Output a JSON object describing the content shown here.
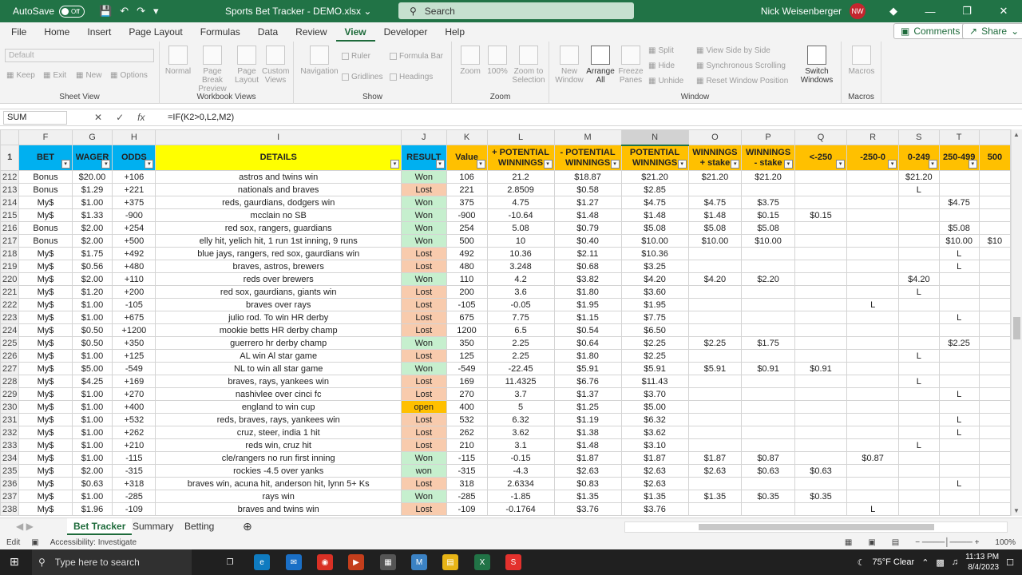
{
  "titlebar": {
    "autosave_label": "AutoSave",
    "autosave_state": "Off",
    "doc_title": "Sports Bet Tracker - DEMO.xlsx",
    "search_placeholder": "Search",
    "user_name": "Nick Weisenberger",
    "user_initials": "NW"
  },
  "menu": [
    "File",
    "Home",
    "Insert",
    "Page Layout",
    "Formulas",
    "Data",
    "Review",
    "View",
    "Developer",
    "Help"
  ],
  "menu_active": "View",
  "comments_label": "Comments",
  "share_label": "Share",
  "ribbon": {
    "sheet_view": {
      "dropdown": "Default",
      "keep": "Keep",
      "exit": "Exit",
      "new": "New",
      "options": "Options",
      "label": "Sheet View"
    },
    "workbook_views": {
      "normal": "Normal",
      "page_break": "Page Break Preview",
      "page_layout": "Page Layout",
      "custom": "Custom Views",
      "label": "Workbook Views"
    },
    "show": {
      "navigation": "Navigation",
      "ruler": "Ruler",
      "formula_bar": "Formula Bar",
      "gridlines": "Gridlines",
      "headings": "Headings",
      "label": "Show"
    },
    "zoom": {
      "zoom": "Zoom",
      "hundred": "100%",
      "to_selection": "Zoom to Selection",
      "label": "Zoom"
    },
    "window": {
      "new_window": "New Window",
      "arrange_all": "Arrange All",
      "freeze": "Freeze Panes",
      "split": "Split",
      "hide": "Hide",
      "unhide": "Unhide",
      "side_by_side": "View Side by Side",
      "sync_scroll": "Synchronous Scrolling",
      "reset_pos": "Reset Window Position",
      "switch": "Switch Windows",
      "label": "Window"
    },
    "macros": {
      "macros": "Macros",
      "label": "Macros"
    }
  },
  "formula_bar": {
    "name_box": "SUM",
    "formula": "=IF(K2>0,L2,M2)"
  },
  "columns": [
    "F",
    "G",
    "H",
    "I",
    "J",
    "K",
    "L",
    "M",
    "N",
    "O",
    "P",
    "Q",
    "R",
    "S",
    "T",
    ""
  ],
  "header_row_number": "1",
  "headers": [
    "BET",
    "WAGER",
    "ODDS",
    "DETAILS",
    "RESULT",
    "Value",
    "+ POTENTIAL WINNINGS",
    "- POTENTIAL WINNINGS",
    "POTENTIAL WINNINGS",
    "WINNINGS + stake",
    "WINNINGS - stake",
    "<-250",
    "-250-0",
    "0-249",
    "250-499",
    "500"
  ],
  "rows": [
    [
      "212",
      "Bonus",
      "$20.00",
      "+106",
      "astros and twins win",
      "Won",
      "106",
      "21.2",
      "$18.87",
      "$21.20",
      "$21.20",
      "$21.20",
      "",
      "",
      "$21.20",
      "",
      ""
    ],
    [
      "213",
      "Bonus",
      "$1.29",
      "+221",
      "nationals and braves",
      "Lost",
      "221",
      "2.8509",
      "$0.58",
      "$2.85",
      "",
      "",
      "",
      "",
      "L",
      "",
      ""
    ],
    [
      "214",
      "My$",
      "$1.00",
      "+375",
      "reds, gaurdians, dodgers win",
      "Won",
      "375",
      "4.75",
      "$1.27",
      "$4.75",
      "$4.75",
      "$3.75",
      "",
      "",
      "",
      "$4.75",
      ""
    ],
    [
      "215",
      "My$",
      "$1.33",
      "-900",
      "mcclain no SB",
      "Won",
      "-900",
      "-10.64",
      "$1.48",
      "$1.48",
      "$1.48",
      "$0.15",
      "$0.15",
      "",
      "",
      "",
      ""
    ],
    [
      "216",
      "Bonus",
      "$2.00",
      "+254",
      "red sox, rangers, guardians",
      "Won",
      "254",
      "5.08",
      "$0.79",
      "$5.08",
      "$5.08",
      "$5.08",
      "",
      "",
      "",
      "$5.08",
      ""
    ],
    [
      "217",
      "Bonus",
      "$2.00",
      "+500",
      "elly hit, yelich hit, 1 run 1st inning, 9 runs",
      "Won",
      "500",
      "10",
      "$0.40",
      "$10.00",
      "$10.00",
      "$10.00",
      "",
      "",
      "",
      "$10.00",
      "$10"
    ],
    [
      "218",
      "My$",
      "$1.75",
      "+492",
      "blue jays, rangers, red sox, gaurdians win",
      "Lost",
      "492",
      "10.36",
      "$2.11",
      "$10.36",
      "",
      "",
      "",
      "",
      "",
      "L",
      ""
    ],
    [
      "219",
      "My$",
      "$0.56",
      "+480",
      "braves, astros, brewers",
      "Lost",
      "480",
      "3.248",
      "$0.68",
      "$3.25",
      "",
      "",
      "",
      "",
      "",
      "L",
      ""
    ],
    [
      "220",
      "My$",
      "$2.00",
      "+110",
      "reds over brewers",
      "Won",
      "110",
      "4.2",
      "$3.82",
      "$4.20",
      "$4.20",
      "$2.20",
      "",
      "",
      "$4.20",
      "",
      ""
    ],
    [
      "221",
      "My$",
      "$1.20",
      "+200",
      "red sox, gaurdians, giants win",
      "Lost",
      "200",
      "3.6",
      "$1.80",
      "$3.60",
      "",
      "",
      "",
      "",
      "L",
      "",
      ""
    ],
    [
      "222",
      "My$",
      "$1.00",
      "-105",
      "braves over rays",
      "Lost",
      "-105",
      "-0.05",
      "$1.95",
      "$1.95",
      "",
      "",
      "",
      "L",
      "",
      "",
      ""
    ],
    [
      "223",
      "My$",
      "$1.00",
      "+675",
      "julio rod. To win HR derby",
      "Lost",
      "675",
      "7.75",
      "$1.15",
      "$7.75",
      "",
      "",
      "",
      "",
      "",
      "L",
      ""
    ],
    [
      "224",
      "My$",
      "$0.50",
      "+1200",
      "mookie betts HR derby champ",
      "Lost",
      "1200",
      "6.5",
      "$0.54",
      "$6.50",
      "",
      "",
      "",
      "",
      "",
      "",
      ""
    ],
    [
      "225",
      "My$",
      "$0.50",
      "+350",
      "guerrero hr derby champ",
      "Won",
      "350",
      "2.25",
      "$0.64",
      "$2.25",
      "$2.25",
      "$1.75",
      "",
      "",
      "",
      "$2.25",
      ""
    ],
    [
      "226",
      "My$",
      "$1.00",
      "+125",
      "AL win Al star game",
      "Lost",
      "125",
      "2.25",
      "$1.80",
      "$2.25",
      "",
      "",
      "",
      "",
      "L",
      "",
      ""
    ],
    [
      "227",
      "My$",
      "$5.00",
      "-549",
      "NL to win all star game",
      "Won",
      "-549",
      "-22.45",
      "$5.91",
      "$5.91",
      "$5.91",
      "$0.91",
      "$0.91",
      "",
      "",
      "",
      ""
    ],
    [
      "228",
      "My$",
      "$4.25",
      "+169",
      "braves, rays, yankees win",
      "Lost",
      "169",
      "11.4325",
      "$6.76",
      "$11.43",
      "",
      "",
      "",
      "",
      "L",
      "",
      ""
    ],
    [
      "229",
      "My$",
      "$1.00",
      "+270",
      "nashivlee over cinci fc",
      "Lost",
      "270",
      "3.7",
      "$1.37",
      "$3.70",
      "",
      "",
      "",
      "",
      "",
      "L",
      ""
    ],
    [
      "230",
      "My$",
      "$1.00",
      "+400",
      "england to win cup",
      "open",
      "400",
      "5",
      "$1.25",
      "$5.00",
      "",
      "",
      "",
      "",
      "",
      "",
      ""
    ],
    [
      "231",
      "My$",
      "$1.00",
      "+532",
      "reds, braves, rays, yankees win",
      "Lost",
      "532",
      "6.32",
      "$1.19",
      "$6.32",
      "",
      "",
      "",
      "",
      "",
      "L",
      ""
    ],
    [
      "232",
      "My$",
      "$1.00",
      "+262",
      "cruz, steer, india 1 hit",
      "Lost",
      "262",
      "3.62",
      "$1.38",
      "$3.62",
      "",
      "",
      "",
      "",
      "",
      "L",
      ""
    ],
    [
      "233",
      "My$",
      "$1.00",
      "+210",
      "reds win, cruz hit",
      "Lost",
      "210",
      "3.1",
      "$1.48",
      "$3.10",
      "",
      "",
      "",
      "",
      "L",
      "",
      ""
    ],
    [
      "234",
      "My$",
      "$1.00",
      "-115",
      "cle/rangers no run first inning",
      "Won",
      "-115",
      "-0.15",
      "$1.87",
      "$1.87",
      "$1.87",
      "$0.87",
      "",
      "$0.87",
      "",
      "",
      ""
    ],
    [
      "235",
      "My$",
      "$2.00",
      "-315",
      "rockies -4.5 over yanks",
      "won",
      "-315",
      "-4.3",
      "$2.63",
      "$2.63",
      "$2.63",
      "$0.63",
      "$0.63",
      "",
      "",
      "",
      ""
    ],
    [
      "236",
      "My$",
      "$0.63",
      "+318",
      "braves win, acuna hit, anderson hit, lynn 5+ Ks",
      "Lost",
      "318",
      "2.6334",
      "$0.83",
      "$2.63",
      "",
      "",
      "",
      "",
      "",
      "L",
      ""
    ],
    [
      "237",
      "My$",
      "$1.00",
      "-285",
      "rays win",
      "Won",
      "-285",
      "-1.85",
      "$1.35",
      "$1.35",
      "$1.35",
      "$0.35",
      "$0.35",
      "",
      "",
      "",
      ""
    ],
    [
      "238",
      "My$",
      "$1.96",
      "-109",
      "braves and twins win",
      "Lost",
      "-109",
      "-0.1764",
      "$3.76",
      "$3.76",
      "",
      "",
      "",
      "L",
      "",
      "",
      ""
    ]
  ],
  "sheet_tabs": [
    "Bet Tracker",
    "Summary",
    "Betting"
  ],
  "active_sheet": "Bet Tracker",
  "status": {
    "mode": "Edit",
    "accessibility": "Accessibility: Investigate",
    "zoom": "100%"
  },
  "taskbar": {
    "search": "Type here to search",
    "weather": "75°F Clear",
    "time": "11:13 PM",
    "date": "8/4/2023"
  },
  "colors": {
    "excel_green": "#217346",
    "won": "#c6efce",
    "lost": "#f8cbad",
    "open": "#ffc000",
    "header_blue": "#00b0f0",
    "header_yellow": "#ffff00",
    "header_orange": "#ffc000"
  }
}
